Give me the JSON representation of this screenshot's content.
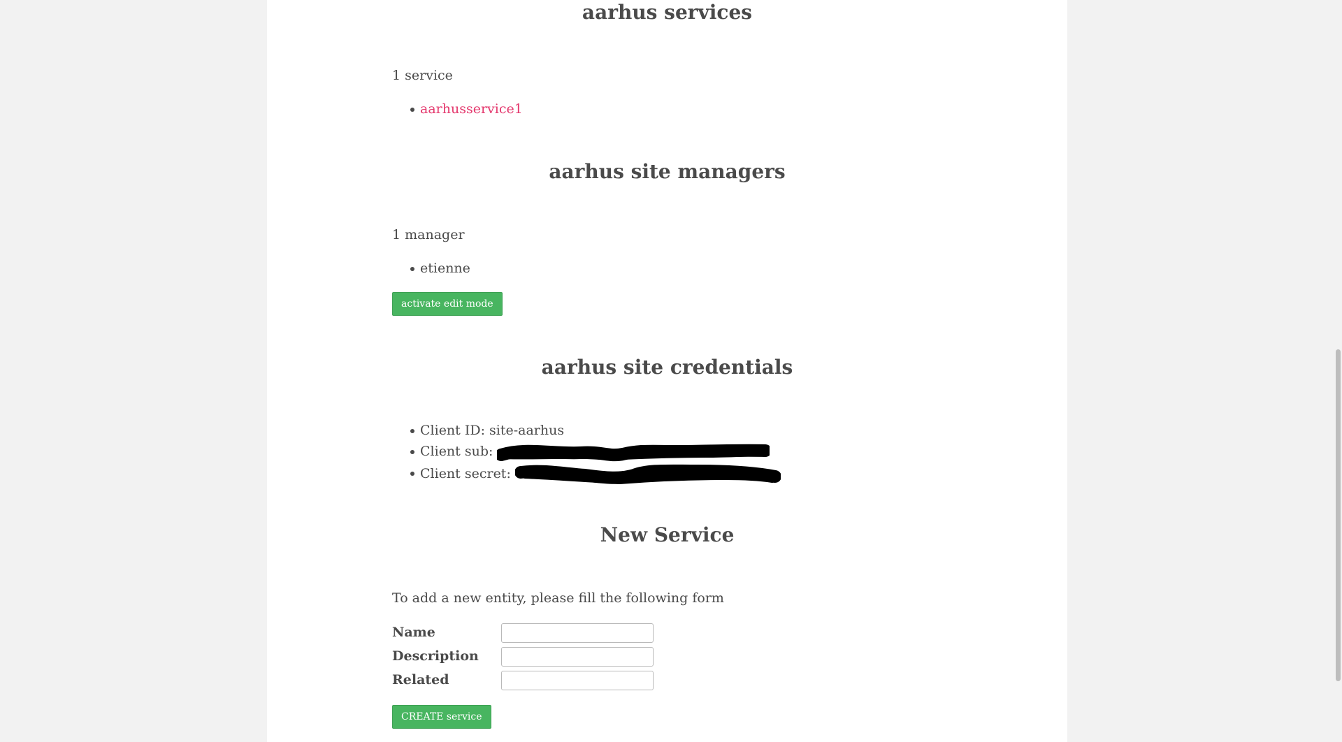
{
  "services": {
    "heading": "aarhus services",
    "count_label": "1 service",
    "items": [
      {
        "label": "aarhusservice1"
      }
    ]
  },
  "managers": {
    "heading": "aarhus site managers",
    "count_label": "1 manager",
    "items": [
      {
        "label": "etienne"
      }
    ],
    "edit_button": "activate edit mode"
  },
  "credentials": {
    "heading": "aarhus site credentials",
    "client_id_label": "Client ID: site-aarhus",
    "client_sub_label": "Client sub:",
    "client_secret_label": "Client secret:"
  },
  "new_service": {
    "heading": "New Service",
    "intro": "To add a new entity, please fill the following form",
    "fields": {
      "name_label": "Name",
      "name_value": "",
      "description_label": "Description",
      "description_value": "",
      "related_label": "Related",
      "related_value": ""
    },
    "create_button": "CREATE service"
  },
  "colors": {
    "link": "#e4386d",
    "button": "#48b560",
    "text": "#4a4a4a",
    "page_bg": "#ffffff",
    "outer_bg": "#f2f2f2"
  }
}
